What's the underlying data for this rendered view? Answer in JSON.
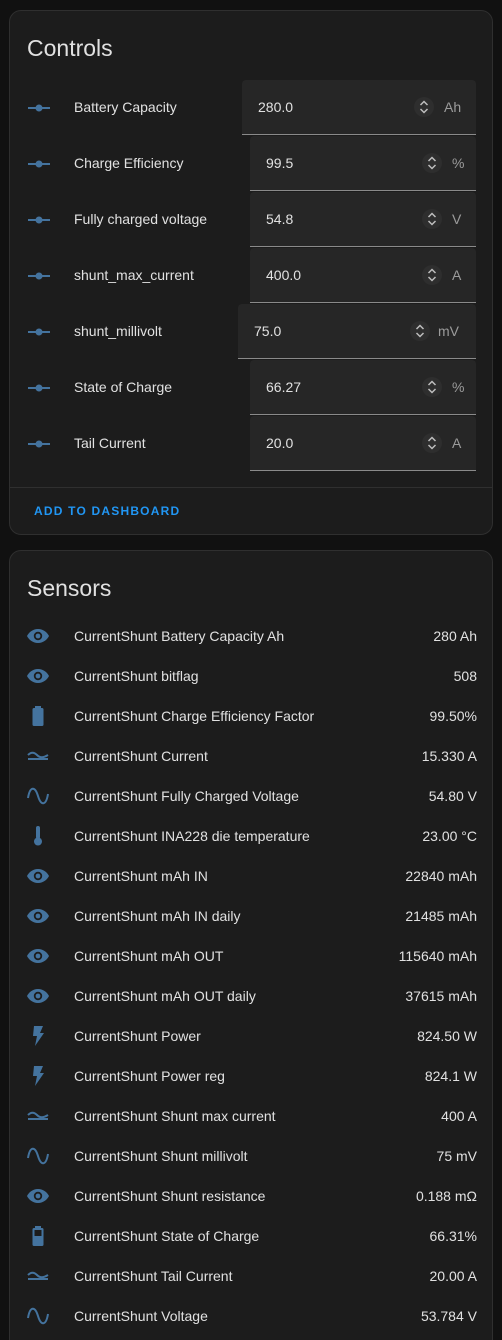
{
  "colors": {
    "background": "#111111",
    "card": "#1c1c1c",
    "icon": "#44739e",
    "accent": "#2196f3",
    "text": "#e1e1e1",
    "muted": "#9b9b9b"
  },
  "controls": {
    "title": "Controls",
    "add_button_label": "ADD TO DASHBOARD",
    "rows": [
      {
        "label": "Battery Capacity",
        "value": "280.0",
        "unit": "Ah",
        "icon": "slider-icon"
      },
      {
        "label": "Charge Efficiency",
        "value": "99.5",
        "unit": "%",
        "icon": "slider-icon"
      },
      {
        "label": "Fully charged voltage",
        "value": "54.8",
        "unit": "V",
        "icon": "slider-icon"
      },
      {
        "label": "shunt_max_current",
        "value": "400.0",
        "unit": "A",
        "icon": "slider-icon"
      },
      {
        "label": "shunt_millivolt",
        "value": "75.0",
        "unit": "mV",
        "icon": "slider-icon"
      },
      {
        "label": "State of Charge",
        "value": "66.27",
        "unit": "%",
        "icon": "slider-icon"
      },
      {
        "label": "Tail Current",
        "value": "20.0",
        "unit": "A",
        "icon": "slider-icon"
      }
    ]
  },
  "sensors": {
    "title": "Sensors",
    "rows": [
      {
        "label": "CurrentShunt Battery Capacity Ah",
        "value": "280 Ah",
        "icon": "eye-icon"
      },
      {
        "label": "CurrentShunt bitflag",
        "value": "508",
        "icon": "eye-icon"
      },
      {
        "label": "CurrentShunt Charge Efficiency Factor",
        "value": "99.50%",
        "icon": "battery-icon"
      },
      {
        "label": "CurrentShunt Current",
        "value": "15.330 A",
        "icon": "current-dc-icon"
      },
      {
        "label": "CurrentShunt Fully Charged Voltage",
        "value": "54.80 V",
        "icon": "sine-wave-icon"
      },
      {
        "label": "CurrentShunt INA228 die temperature",
        "value": "23.00 °C",
        "icon": "thermometer-icon"
      },
      {
        "label": "CurrentShunt mAh IN",
        "value": "22840 mAh",
        "icon": "eye-icon"
      },
      {
        "label": "CurrentShunt mAh IN daily",
        "value": "21485 mAh",
        "icon": "eye-icon"
      },
      {
        "label": "CurrentShunt mAh OUT",
        "value": "115640 mAh",
        "icon": "eye-icon"
      },
      {
        "label": "CurrentShunt mAh OUT daily",
        "value": "37615 mAh",
        "icon": "eye-icon"
      },
      {
        "label": "CurrentShunt Power",
        "value": "824.50 W",
        "icon": "flash-icon"
      },
      {
        "label": "CurrentShunt Power reg",
        "value": "824.1 W",
        "icon": "flash-icon"
      },
      {
        "label": "CurrentShunt Shunt max current",
        "value": "400 A",
        "icon": "current-dc-icon"
      },
      {
        "label": "CurrentShunt Shunt millivolt",
        "value": "75 mV",
        "icon": "sine-wave-icon"
      },
      {
        "label": "CurrentShunt Shunt resistance",
        "value": "0.188 mΩ",
        "icon": "eye-icon"
      },
      {
        "label": "CurrentShunt State of Charge",
        "value": "66.31%",
        "icon": "battery-medium-icon"
      },
      {
        "label": "CurrentShunt Tail Current",
        "value": "20.00 A",
        "icon": "current-dc-icon"
      },
      {
        "label": "CurrentShunt Voltage",
        "value": "53.784 V",
        "icon": "sine-wave-icon"
      }
    ]
  }
}
